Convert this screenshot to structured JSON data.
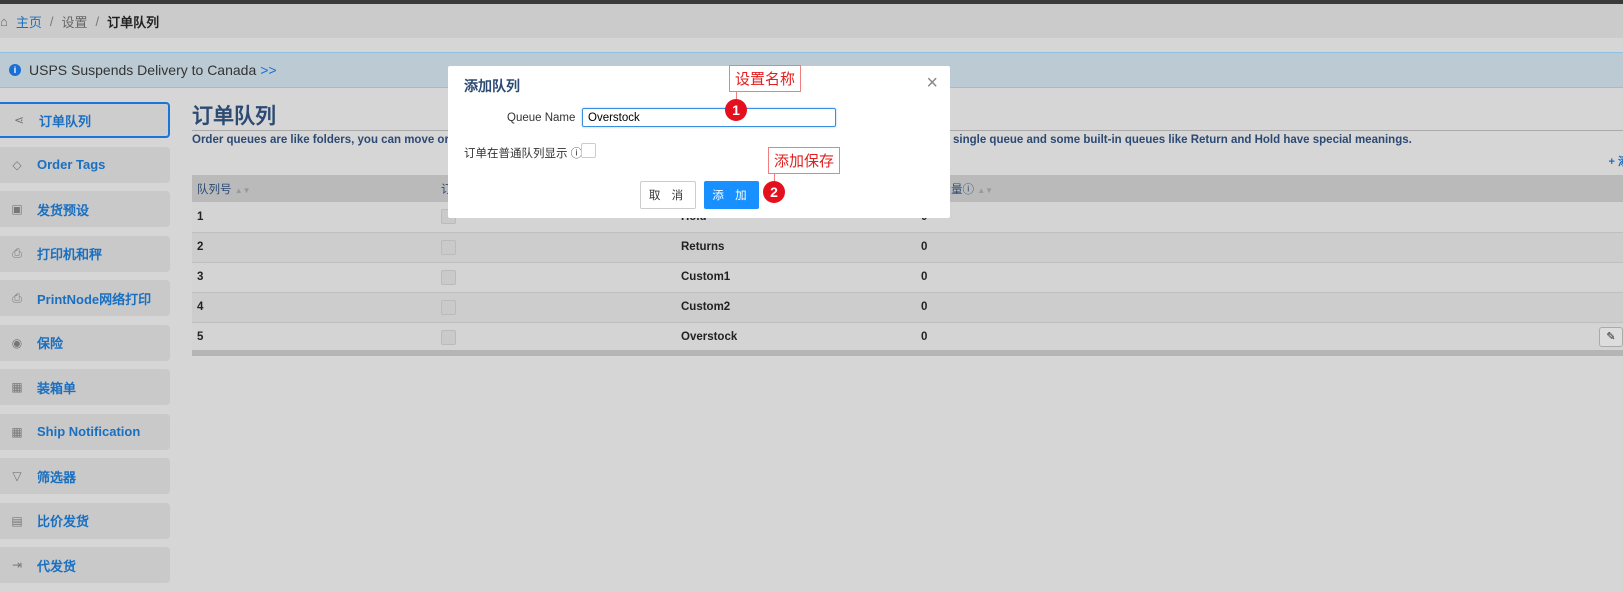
{
  "breadcrumb": {
    "home": "主页",
    "settings": "设置",
    "current": "订单队列"
  },
  "banner": {
    "text": "USPS Suspends Delivery to Canada",
    "more": ">>"
  },
  "sidebar": {
    "items": [
      {
        "label": "订单队列",
        "icon": "share-icon"
      },
      {
        "label": "Order Tags",
        "icon": "tag-icon"
      },
      {
        "label": "发货预设",
        "icon": "preset-icon"
      },
      {
        "label": "打印机和秤",
        "icon": "printer-icon"
      },
      {
        "label": "PrintNode网络打印",
        "icon": "printer-icon"
      },
      {
        "label": "保险",
        "icon": "eye-icon"
      },
      {
        "label": "装箱单",
        "icon": "grid-icon"
      },
      {
        "label": "Ship Notification",
        "icon": "grid-icon"
      },
      {
        "label": "筛选器",
        "icon": "filter-icon"
      },
      {
        "label": "比价发货",
        "icon": "store-icon"
      },
      {
        "label": "代发货",
        "icon": "exit-icon"
      }
    ]
  },
  "main": {
    "title": "订单队列",
    "desc_left": "Order queues are like folders, you can move orde",
    "desc_right": "single queue and some built-in queues like Return and Hold have special meanings.",
    "add_link": "+ 添",
    "columns": [
      "队列号",
      "订",
      "",
      "量"
    ],
    "rows": [
      {
        "id": "1",
        "name": "Hold",
        "count": "0"
      },
      {
        "id": "2",
        "name": "Returns",
        "count": "0"
      },
      {
        "id": "3",
        "name": "Custom1",
        "count": "0"
      },
      {
        "id": "4",
        "name": "Custom2",
        "count": "0"
      },
      {
        "id": "5",
        "name": "Overstock",
        "count": "0"
      }
    ]
  },
  "dialog": {
    "title": "添加队列",
    "queue_name_label": "Queue Name",
    "queue_name_value": "Overstock",
    "show_label": "订单在普通队列显示",
    "cancel": "取 消",
    "ok": "添 加"
  },
  "annotations": {
    "note1": "设置名称",
    "badge1": "1",
    "note2": "添加保存",
    "badge2": "2"
  }
}
